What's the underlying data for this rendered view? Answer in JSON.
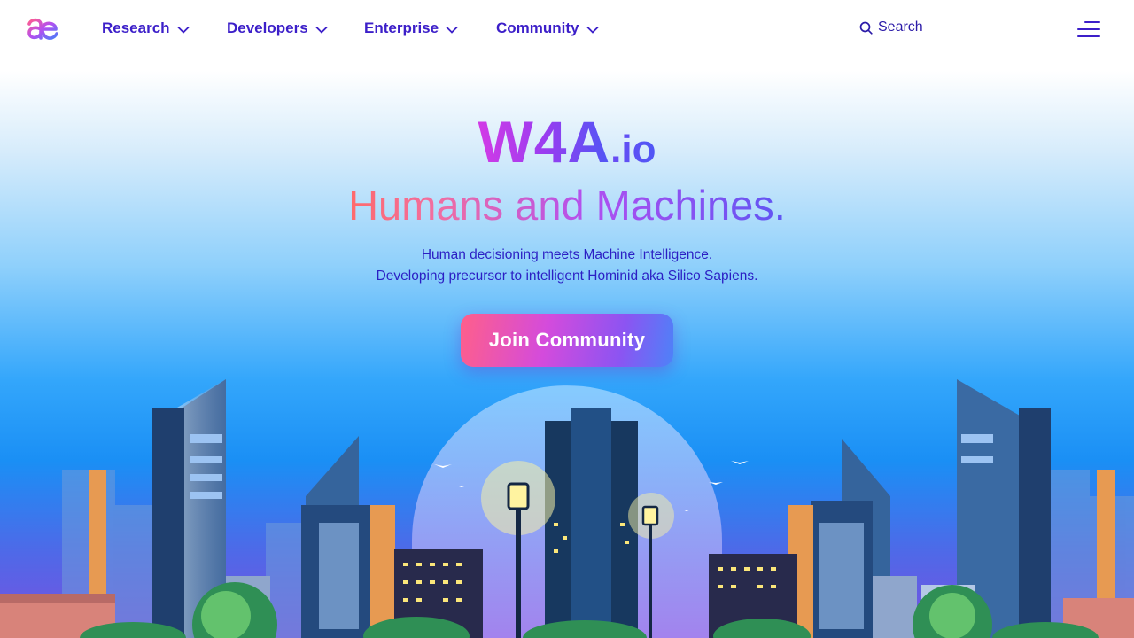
{
  "nav": {
    "logo_icon": "ae-logo-icon",
    "items": [
      {
        "label": "Research"
      },
      {
        "label": "Developers"
      },
      {
        "label": "Enterprise"
      },
      {
        "label": "Community"
      }
    ],
    "search_label": "Search",
    "menu_icon": "hamburger-menu-icon"
  },
  "hero": {
    "brand": "W4A",
    "brand_suffix": ".io",
    "tagline": "Humans and Machines.",
    "subtitle_line1": "Human decisioning meets Machine Intelligence.",
    "subtitle_line2": "Developing precursor to intelligent Hominid aka Silico Sapiens.",
    "cta_label": "Join Community"
  },
  "colors": {
    "nav_text": "#3c1fc9",
    "accent_pink": "#ff5f8a",
    "accent_purple": "#8c54f2",
    "accent_blue": "#4d82f8",
    "sky_top": "#d7ecfb",
    "sky_bottom": "#7b4fe0"
  },
  "illustration": "city-skyline-illustration"
}
